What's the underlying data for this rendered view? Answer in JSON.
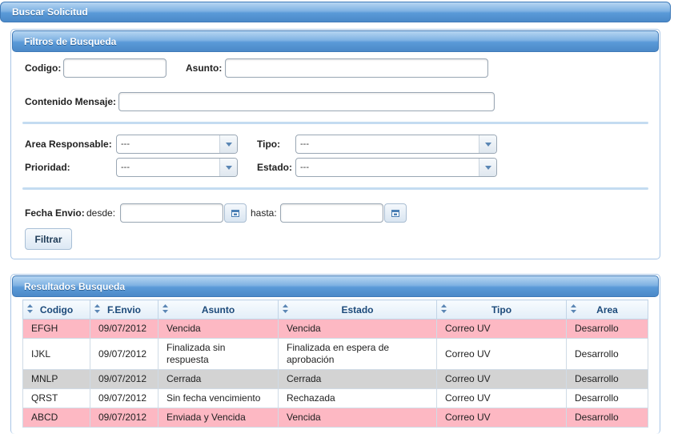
{
  "header": {
    "title": "Buscar Solicitud"
  },
  "filters": {
    "title": "Filtros de Busqueda",
    "codigo_label": "Codigo:",
    "codigo_value": "",
    "asunto_label": "Asunto:",
    "asunto_value": "",
    "contenido_label": "Contenido Mensaje:",
    "contenido_value": "",
    "area_label": "Area Responsable:",
    "area_value": "---",
    "tipo_label": "Tipo:",
    "tipo_value": "---",
    "prioridad_label": "Prioridad:",
    "prioridad_value": "---",
    "estado_label": "Estado:",
    "estado_value": "---",
    "fecha_label": "Fecha Envio:",
    "desde_label": "desde:",
    "desde_value": "",
    "hasta_label": "hasta:",
    "hasta_value": "",
    "filter_button": "Filtrar"
  },
  "results": {
    "title": "Resultados Busqueda",
    "columns": [
      "Codigo",
      "F.Envio",
      "Asunto",
      "Estado",
      "Tipo",
      "Area"
    ],
    "rows": [
      {
        "cells": [
          "EFGH",
          "09/07/2012",
          "Vencida",
          "Vencida",
          "Correo UV",
          "Desarrollo"
        ],
        "color": "pink"
      },
      {
        "cells": [
          "IJKL",
          "09/07/2012",
          "Finalizada sin respuesta",
          "Finalizada en espera de aprobación",
          "Correo UV",
          "Desarrollo"
        ],
        "color": "white"
      },
      {
        "cells": [
          "MNLP",
          "09/07/2012",
          "Cerrada",
          "Cerrada",
          "Correo UV",
          "Desarrollo"
        ],
        "color": "gray"
      },
      {
        "cells": [
          "QRST",
          "09/07/2012",
          "Sin fecha vencimiento",
          "Rechazada",
          "Correo UV",
          "Desarrollo"
        ],
        "color": "white"
      },
      {
        "cells": [
          "ABCD",
          "09/07/2012",
          "Enviada y Vencida",
          "Vencida",
          "Correo UV",
          "Desarrollo"
        ],
        "color": "pink"
      }
    ]
  },
  "colors": {
    "header_blue": "#5a9ad8",
    "row_pink": "#fdb8c3",
    "row_gray": "#d3d3d3",
    "column_header_text": "#1c4a7a"
  },
  "icons": {
    "sort": "sort-arrows-icon",
    "calendar": "calendar-icon",
    "dropdown": "chevron-down-icon"
  }
}
